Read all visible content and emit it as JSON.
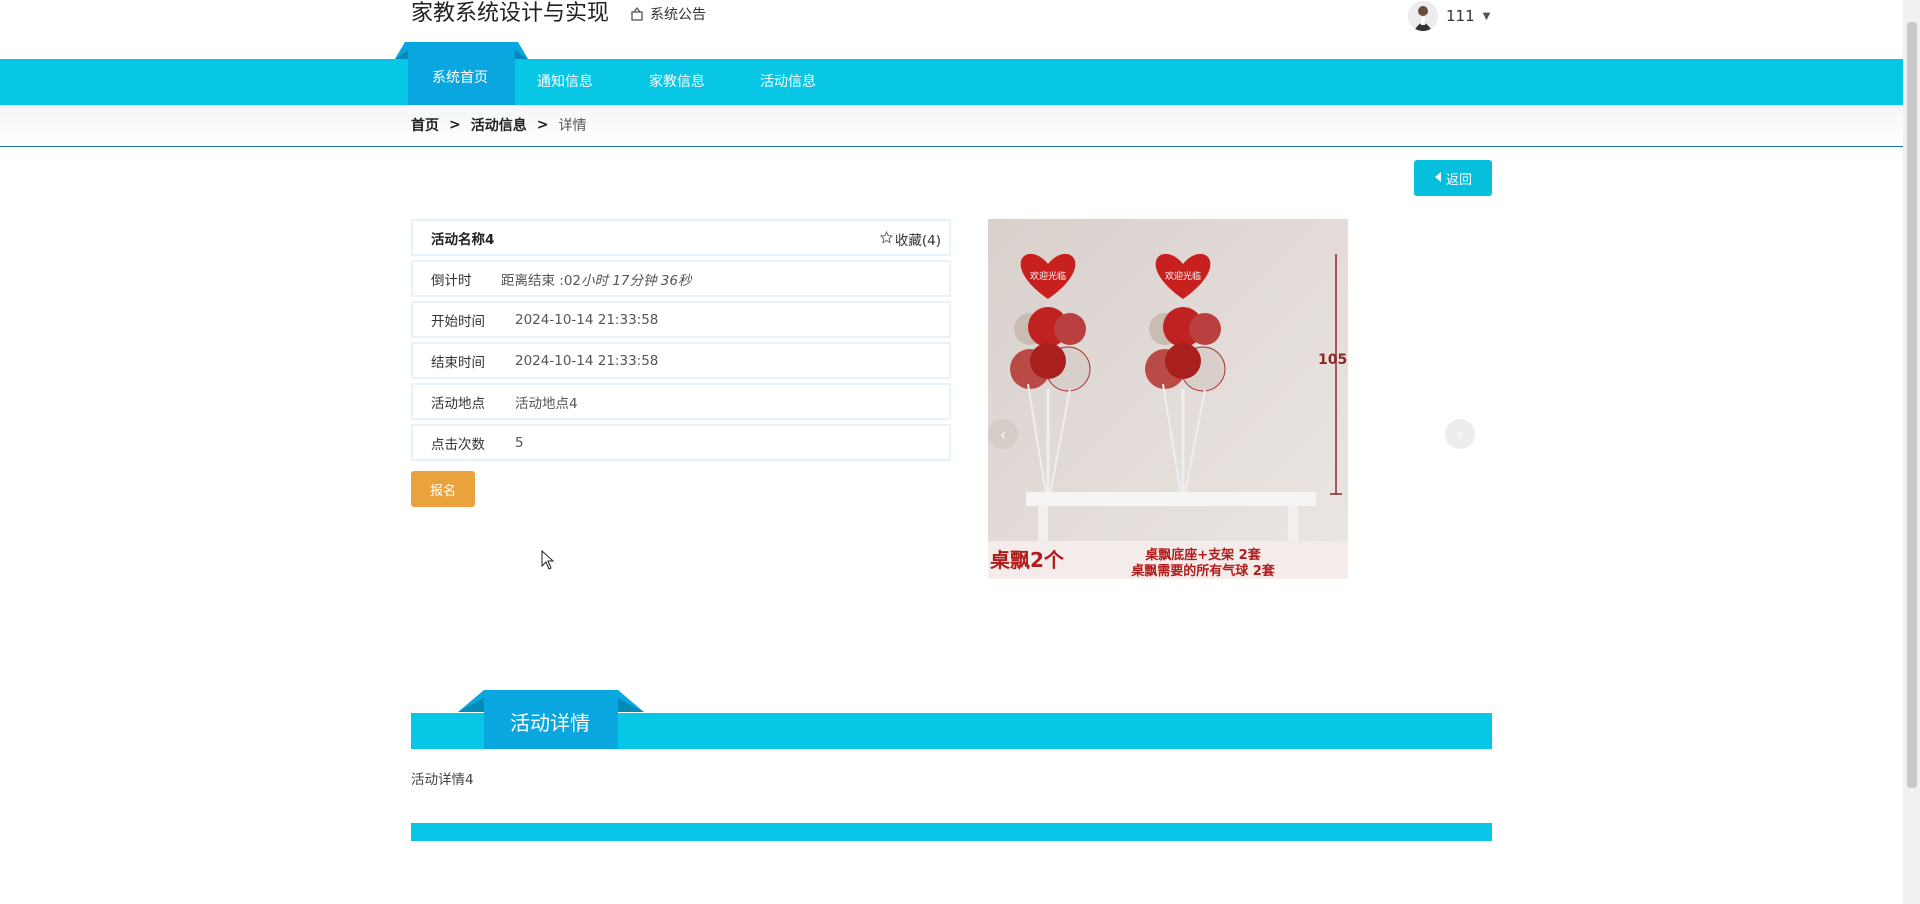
{
  "header": {
    "site_title": "家教系统设计与实现",
    "notice_label": "系统公告",
    "user_name": "111"
  },
  "nav": {
    "items": [
      {
        "label": "系统首页",
        "active": true
      },
      {
        "label": "通知信息",
        "active": false
      },
      {
        "label": "家教信息",
        "active": false
      },
      {
        "label": "活动信息",
        "active": false
      }
    ]
  },
  "breadcrumb": {
    "items": [
      "首页",
      "活动信息",
      "详情"
    ],
    "separator": ">"
  },
  "actions": {
    "back_label": "返回",
    "signup_label": "报名"
  },
  "activity": {
    "name": "活动名称4",
    "favorite_label": "收藏(4)",
    "countdown_label": "倒计时",
    "countdown_prefix": "距离结束 :02",
    "countdown_rest": "小时 17分钟 36秒",
    "start_label": "开始时间",
    "start_value": "2024-10-14 21:33:58",
    "end_label": "结束时间",
    "end_value": "2024-10-14 21:33:58",
    "location_label": "活动地点",
    "location_value": "活动地点4",
    "clicks_label": "点击次数",
    "clicks_value": "5"
  },
  "carousel": {
    "image_text": {
      "balloon_label_left": "欢迎光临",
      "balloon_label_right": "欢迎光临",
      "size_mark": "105",
      "caption_left": "桌飘2个",
      "caption_right_1": "桌飘底座+支架  2套",
      "caption_right_2": "桌飘需要的所有气球  2套"
    }
  },
  "detail": {
    "section_title": "活动详情",
    "content": "活动详情4"
  },
  "colors": {
    "primary": "#08c7e6",
    "tab_dark": "#0aa6df",
    "signup": "#eaa33c"
  }
}
